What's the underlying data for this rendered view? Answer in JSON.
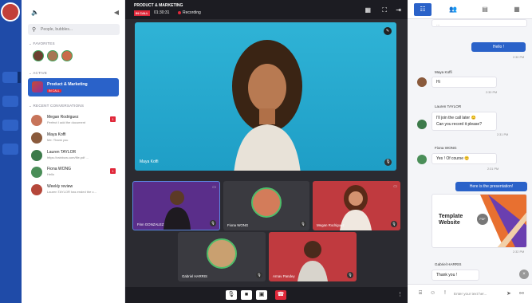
{
  "sidebar": {
    "search_placeholder": "People, bubbles...",
    "favorites_label": "FAVORITES",
    "active_label": "ACTIVE",
    "active_bubble": {
      "name": "Product & Marketing",
      "tag": "IN CALL"
    },
    "recent_label": "RECENT CONVERSATIONS",
    "conversations": [
      {
        "name": "Megan Rodriguez",
        "preview": "Perfect I add the document",
        "badge": "1",
        "color": "#c7745a"
      },
      {
        "name": "Maya Koffi",
        "preview": "Me: Thank you",
        "badge": "",
        "color": "#8a5a3c"
      },
      {
        "name": "Lauren TAYLOR",
        "preview": "https://rainbow.com/file.pdf ...",
        "badge": "",
        "color": "#3c7a4a"
      },
      {
        "name": "Fiona WONG",
        "preview": "Hello",
        "badge": "1",
        "color": "#4a8e58"
      },
      {
        "name": "Weekly review",
        "preview": "Lauren TAYLOR has ended the c...",
        "badge": "",
        "color": "#b5473a"
      }
    ]
  },
  "meeting": {
    "title": "PRODUCT & MARKETING",
    "incall": "IN CALL",
    "time": "01:30:31",
    "recording": "Recording",
    "main_speaker": "Maya Koffi",
    "participants": [
      {
        "name": "Finn GONZALEZ",
        "bg": "#5a2e8a"
      },
      {
        "name": "Fiona WONG",
        "bg": "#3a3a40"
      },
      {
        "name": "Megan Rodriguez",
        "bg": "#c03a3f"
      },
      {
        "name": "Gabriel HARRIS",
        "bg": "#3a3a40"
      },
      {
        "name": "Arnav Pandey",
        "bg": "#c03a3f"
      }
    ]
  },
  "chat": {
    "top_text": "...",
    "messages": {
      "m1": {
        "text": "Hello !",
        "time": "2:30 PM"
      },
      "m2": {
        "sender": "Maya Koffi",
        "text": "Hi",
        "time": "2:30 PM"
      },
      "m3": {
        "sender": "Lauren TAYLOR",
        "line1": "I'll join the call later 😊",
        "line2": "Can you record it please?",
        "time": "2:31 PM"
      },
      "m4": {
        "sender": "Fiona WONG",
        "text": "Yes ! Of course 😊",
        "time": "2:31 PM"
      },
      "m5": {
        "text": "Here is the presentation!",
        "card_title": "Template Website",
        "card_badge": "PDF",
        "time": "2:32 PM"
      },
      "m6": {
        "sender": "Gabriel HARRIS",
        "text": "Thank you !"
      }
    },
    "compose_placeholder": "Enter your text her..."
  }
}
